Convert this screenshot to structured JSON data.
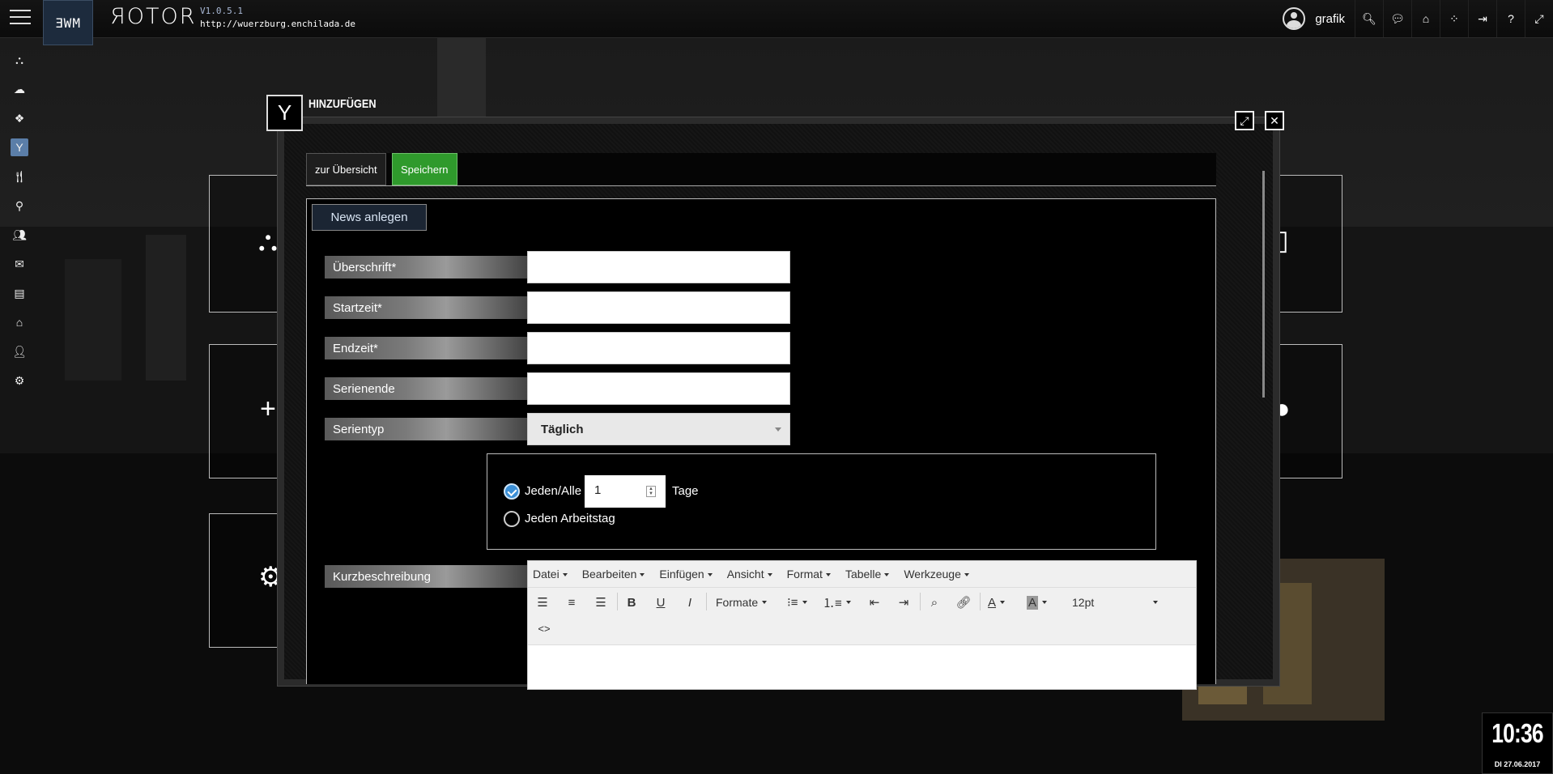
{
  "header": {
    "logo_text": "ƎWM",
    "brand": "ЯOTOR",
    "version": "V1.0.5.1",
    "url": "http://wuerzburg.enchilada.de",
    "username": "grafik",
    "icons": [
      "search-icon",
      "chat-icon",
      "home-icon",
      "spinner-icon",
      "logout-icon",
      "help-icon",
      "expand-icon"
    ]
  },
  "sidebar": {
    "items": [
      {
        "name": "sitemap-icon",
        "glyph": "⛬"
      },
      {
        "name": "cloud-icon",
        "glyph": "☁"
      },
      {
        "name": "cube-icon",
        "glyph": "❖"
      },
      {
        "name": "cocktail-icon",
        "glyph": "Y"
      },
      {
        "name": "cutlery-icon",
        "glyph": "🍴"
      },
      {
        "name": "map-marker-icon",
        "glyph": "⚲"
      },
      {
        "name": "users-icon",
        "glyph": "👥"
      },
      {
        "name": "envelope-icon",
        "glyph": "✉"
      },
      {
        "name": "archive-icon",
        "glyph": "▤"
      },
      {
        "name": "home-icon",
        "glyph": "⌂"
      },
      {
        "name": "user-icon",
        "glyph": "👤"
      },
      {
        "name": "cogs-icon",
        "glyph": "⚙"
      }
    ]
  },
  "modal": {
    "title": "HINZUFÜGEN",
    "tabs": {
      "back": "zur Übersicht",
      "save": "Speichern"
    },
    "panel_title": "News anlegen",
    "fields": {
      "headline": "Überschrift*",
      "start": "Startzeit*",
      "end": "Endzeit*",
      "series_end": "Serienende",
      "series_type": "Serientyp",
      "short_desc": "Kurzbeschreibung"
    },
    "series_type_value": "Täglich",
    "repeat": {
      "every_label": "Jeden/Alle",
      "every_value": "1",
      "days_label": "Tage",
      "workday_label": "Jeden Arbeitstag"
    },
    "editor": {
      "menus": [
        "Datei",
        "Bearbeiten",
        "Einfügen",
        "Ansicht",
        "Format",
        "Tabelle",
        "Werkzeuge"
      ],
      "formats_label": "Formate",
      "font_size": "12pt",
      "code_label": "<>"
    }
  },
  "clock": {
    "time": "10:36",
    "date": "DI 27.06.2017"
  }
}
